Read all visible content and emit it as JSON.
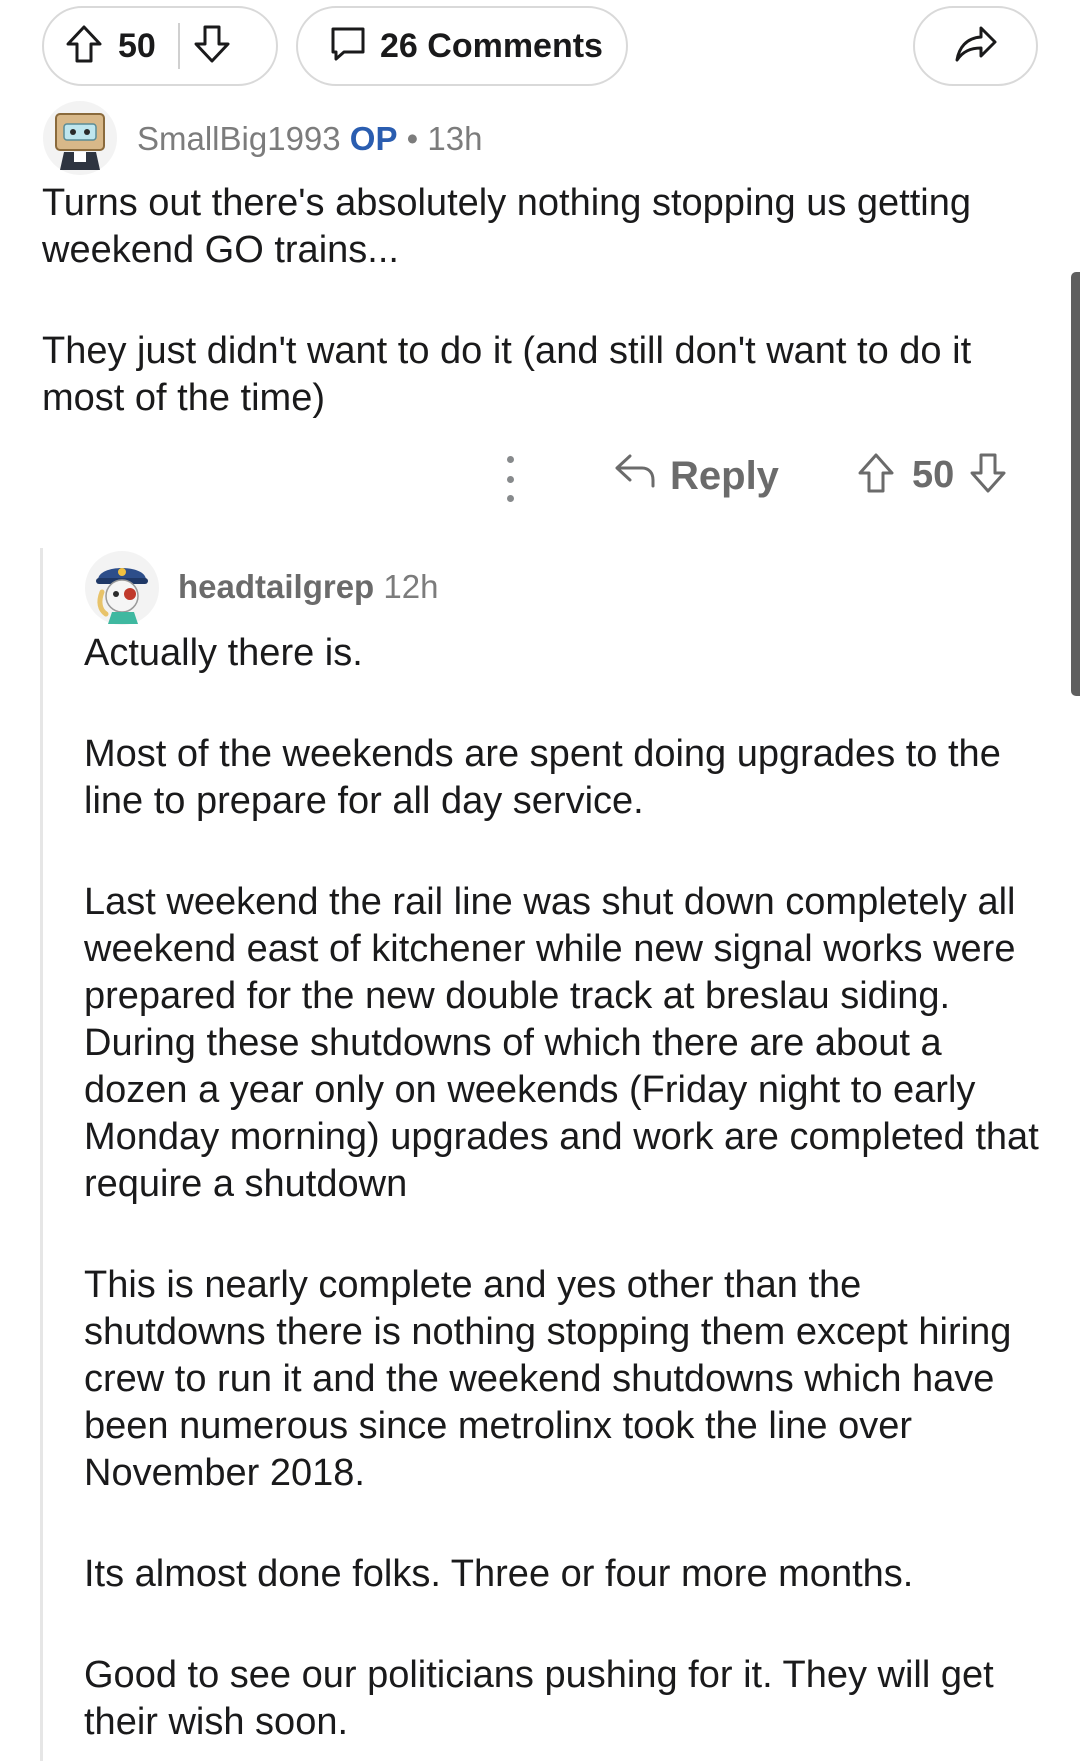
{
  "post_actions": {
    "vote_count": "50",
    "comments_label": "26 Comments"
  },
  "op_comment": {
    "author": "SmallBig1993",
    "op_tag": "OP",
    "separator": "•",
    "age": "13h",
    "paragraphs": [
      "Turns out there's absolutely nothing stopping us getting weekend GO trains...",
      "They just didn't want to do it (and still don't want to do it most of the time)"
    ],
    "reply_label": "Reply",
    "vote_count": "50"
  },
  "reply_comment": {
    "author": "headtailgrep",
    "age": "12h",
    "paragraphs": [
      "Actually there is.",
      "Most of the weekends are spent doing upgrades to the line to prepare for all day service.",
      "Last weekend the rail line was shut down completely all weekend east of kitchener while new signal works were prepared for the new double track at breslau siding. During these shutdowns of which there are about a dozen a year only on weekends (Friday night to early Monday morning) upgrades and work are completed that require a shutdown",
      "This is nearly complete and yes other than the shutdowns there is nothing stopping them except hiring crew to run it and the weekend shutdowns which have been numerous since metrolinx took the line over November 2018.",
      "Its almost done folks. Three or four more months.",
      "Good to see our politicians pushing for it. They will get their wish soon."
    ]
  },
  "icons": {
    "upvote": "arrow-up-outline-icon",
    "downvote": "arrow-down-outline-icon",
    "comments": "speech-bubble-icon",
    "share": "share-arrow-icon",
    "more": "vertical-dots-icon",
    "reply": "reply-arrow-icon"
  },
  "colors": {
    "op_tag": "#2a5db0",
    "meta_text": "#7c7c7c",
    "body_text": "#1a1a1b",
    "border": "#d9d9d9"
  }
}
